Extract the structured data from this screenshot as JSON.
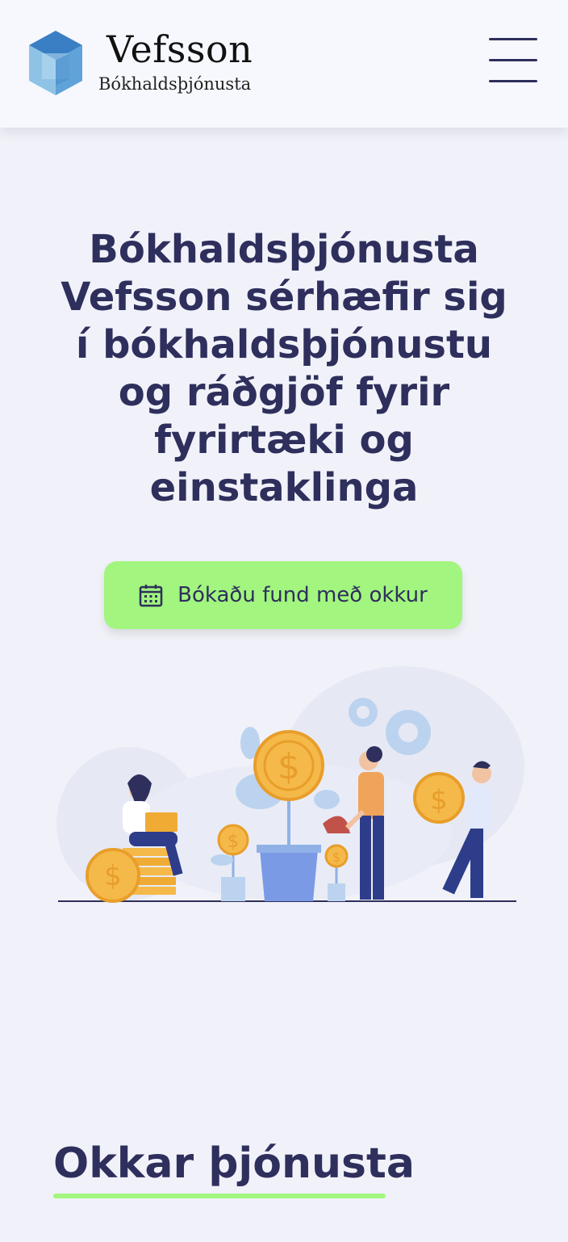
{
  "header": {
    "brand_name": "Vefsson",
    "brand_sub": "Bókhaldsþjónusta",
    "logo_icon": "cube-logo-icon",
    "menu_icon": "hamburger-menu-icon"
  },
  "hero": {
    "title": "Bókhaldsþjónusta Vefsson sérhæfir sig í bókhaldsþjónustu og ráðgjöf fyrir fyrirtæki og einstaklinga",
    "cta_label": "Bókaðu fund með okkur",
    "cta_icon": "calendar-icon"
  },
  "services": {
    "title": "Okkar þjónusta"
  },
  "colors": {
    "background": "#f1f2f9",
    "header_bg": "#f7f8fd",
    "text_primary": "#2e2f5c",
    "accent_green": "#a2f57e",
    "coin_gold": "#f5b94a",
    "logo_blue": "#3a7fc4"
  }
}
